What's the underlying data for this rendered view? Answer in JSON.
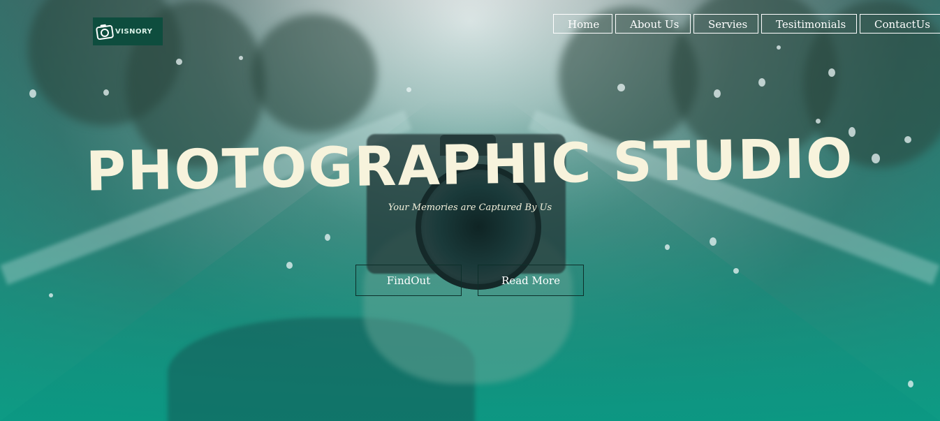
{
  "brand": {
    "name": "VISNORY",
    "icon": "camera-icon",
    "colors": {
      "bg": "#0e4d3e",
      "text": "#d8f0e6"
    }
  },
  "nav": {
    "items": [
      {
        "label": "Home"
      },
      {
        "label": "About Us"
      },
      {
        "label": "Servies"
      },
      {
        "label": "Tesitimonials"
      },
      {
        "label": "ContactUs"
      }
    ]
  },
  "hero": {
    "title": "PHOTOGRAPHIC STUDIO",
    "subtitle": "Your Memories are Captured By Us",
    "buttons": {
      "primary": "FindOut",
      "secondary": "Read More"
    },
    "colors": {
      "title": "#f7f3dc",
      "overlay": "#12a08a",
      "button_border": "#0d2f2a"
    }
  }
}
